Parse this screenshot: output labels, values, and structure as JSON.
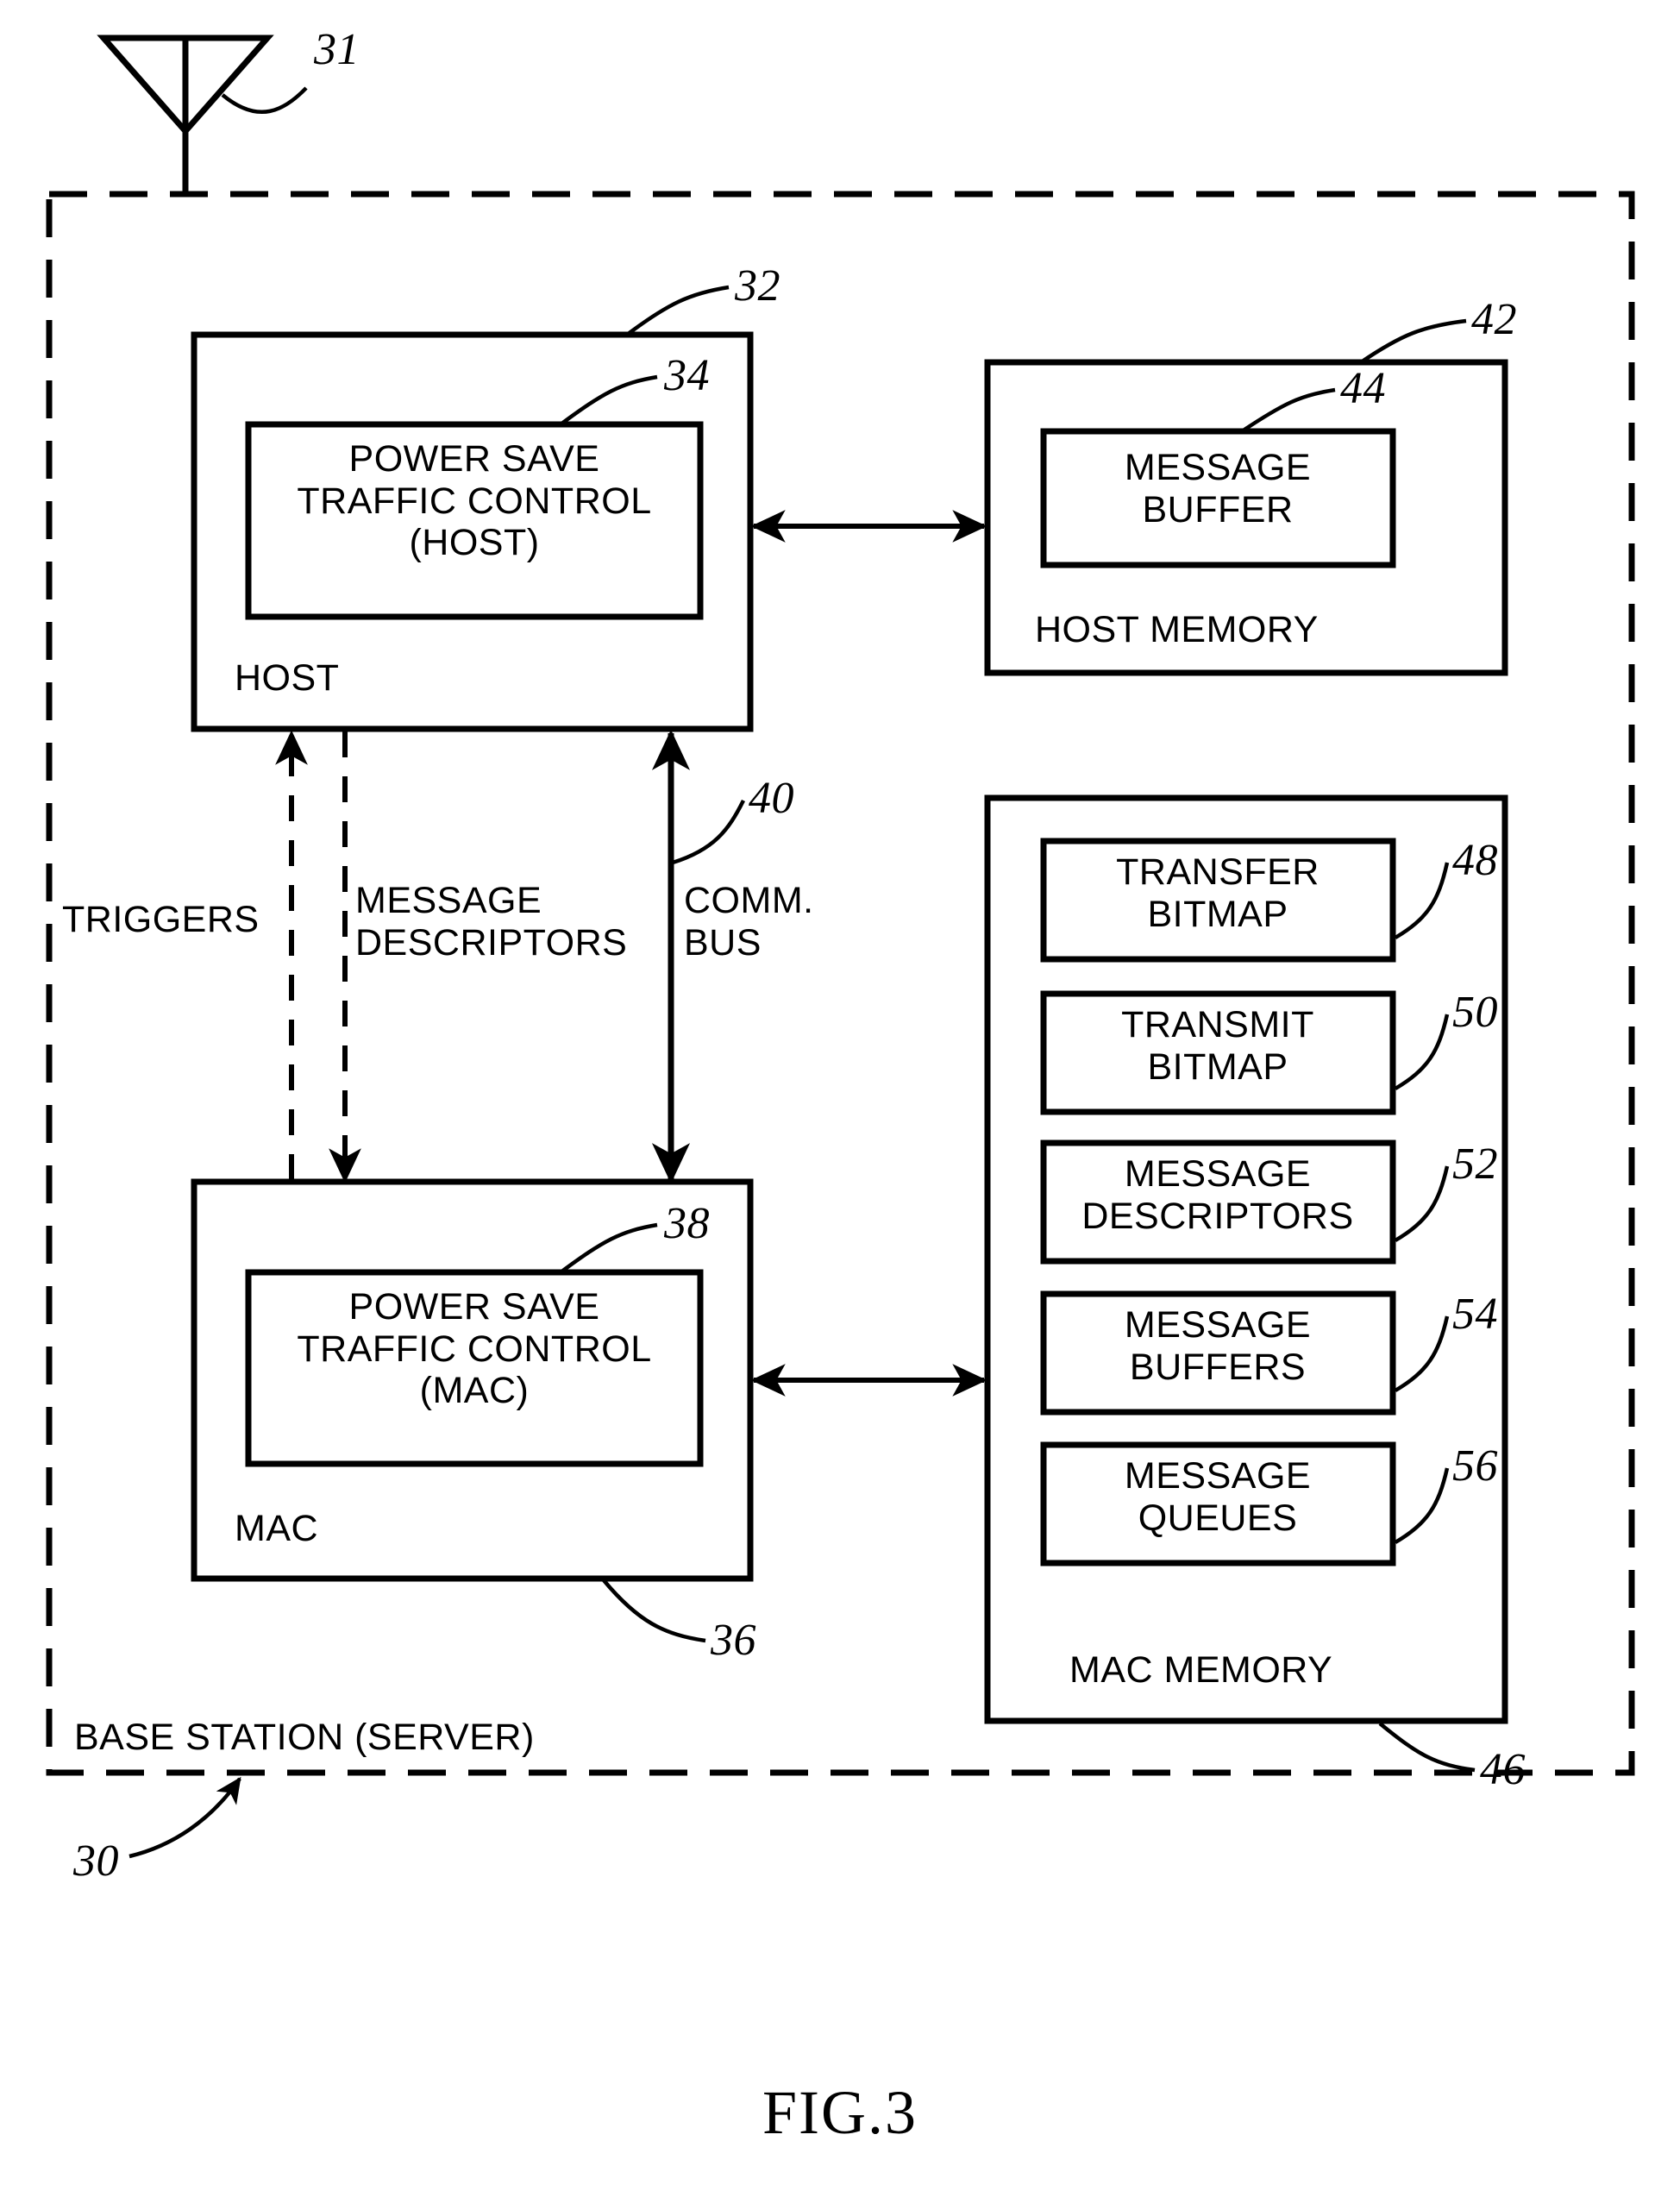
{
  "figure": {
    "caption": "FIG.3",
    "outer_label": "BASE STATION  (SERVER)",
    "outer_ref": "30",
    "antenna_ref": "31"
  },
  "blocks": {
    "host": {
      "label": "HOST",
      "ref": "32",
      "inner": {
        "line1": "POWER  SAVE",
        "line2": "TRAFFIC  CONTROL",
        "line3": "(HOST)",
        "ref": "34"
      }
    },
    "mac": {
      "label": "MAC",
      "ref": "36",
      "inner": {
        "line1": "POWER  SAVE",
        "line2": "TRAFFIC  CONTROL",
        "line3": "(MAC)",
        "ref": "38"
      }
    },
    "host_memory": {
      "label": "HOST  MEMORY",
      "ref": "42",
      "items": [
        {
          "line1": "MESSAGE",
          "line2": "BUFFER",
          "ref": "44"
        }
      ]
    },
    "mac_memory": {
      "label": "MAC  MEMORY",
      "ref": "46",
      "items": [
        {
          "line1": "TRANSFER",
          "line2": "BITMAP",
          "ref": "48"
        },
        {
          "line1": "TRANSMIT",
          "line2": "BITMAP",
          "ref": "50"
        },
        {
          "line1": "MESSAGE",
          "line2": "DESCRIPTORS",
          "ref": "52"
        },
        {
          "line1": "MESSAGE",
          "line2": "BUFFERS",
          "ref": "54"
        },
        {
          "line1": "MESSAGE",
          "line2": "QUEUES",
          "ref": "56"
        }
      ]
    }
  },
  "connections": {
    "triggers": {
      "label": "TRIGGERS",
      "style": "dashed",
      "direction": "up"
    },
    "message_descriptors": {
      "label1": "MESSAGE",
      "label2": "DESCRIPTORS",
      "style": "dashed",
      "direction": "down"
    },
    "comm_bus": {
      "label1": "COMM.",
      "label2": "BUS",
      "ref": "40",
      "style": "solid",
      "direction": "both"
    }
  },
  "colors": {
    "ink": "#000000",
    "paper": "#ffffff"
  }
}
